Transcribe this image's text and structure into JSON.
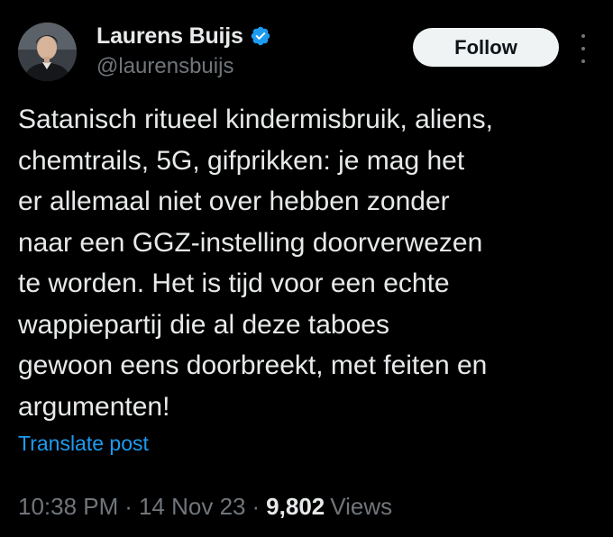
{
  "author": {
    "display_name": "Laurens Buijs",
    "handle": "@laurensbuijs",
    "verified": true,
    "avatar_icon": "profile-photo"
  },
  "actions": {
    "follow_label": "Follow",
    "more_icon": "more-options-icon"
  },
  "post": {
    "text_lines": [
      "Satanisch ritueel kindermisbruik, aliens,",
      "chemtrails, 5G, gifprikken: je mag het",
      "er allemaal niet over hebben zonder",
      "naar een GGZ-instelling doorverwezen",
      "te worden. Het is tijd voor een echte",
      "wappiepartij die al deze taboes",
      "gewoon eens doorbreekt, met feiten en",
      "argumenten!"
    ],
    "translate_label": "Translate post"
  },
  "meta": {
    "time": "10:38 PM",
    "separator": "·",
    "date": "14 Nov 23",
    "views_count": "9,802",
    "views_label": "Views"
  },
  "colors": {
    "background": "#000000",
    "text_primary": "#e7e9ea",
    "text_secondary": "#71767b",
    "link": "#1d9bf0",
    "verified_badge": "#1d9bf0",
    "follow_button_bg": "#eff3f4",
    "follow_button_text": "#0f1419"
  }
}
